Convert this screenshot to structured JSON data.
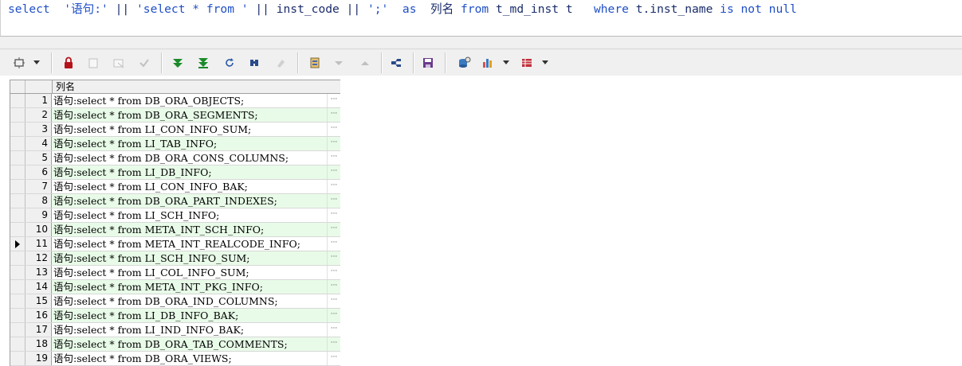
{
  "sql": {
    "tokens": [
      {
        "cls": "kw",
        "text": "select"
      },
      {
        "cls": "id",
        "text": "  "
      },
      {
        "cls": "str",
        "text": "'语句:'"
      },
      {
        "cls": "id",
        "text": " || "
      },
      {
        "cls": "str",
        "text": "'select * from '"
      },
      {
        "cls": "id",
        "text": " || inst_code || "
      },
      {
        "cls": "str",
        "text": "';'"
      },
      {
        "cls": "id",
        "text": "  "
      },
      {
        "cls": "kw",
        "text": "as"
      },
      {
        "cls": "id",
        "text": "  列名 "
      },
      {
        "cls": "kw",
        "text": "from"
      },
      {
        "cls": "id",
        "text": " t_md_inst t   "
      },
      {
        "cls": "kw",
        "text": "where"
      },
      {
        "cls": "id",
        "text": " t.inst_name "
      },
      {
        "cls": "kw",
        "text": "is not null"
      }
    ]
  },
  "toolbar": {
    "icons": [
      "pin-menu-icon",
      "lock-icon",
      "new-record-icon",
      "delete-record-icon",
      "post-icon",
      "fetch-next-icon",
      "fetch-all-icon",
      "refresh-icon",
      "find-icon",
      "clear-icon",
      "query-by-example-icon",
      "previous-icon",
      "next-icon",
      "single-record-view-icon",
      "save-icon",
      "export-icon",
      "chart-icon",
      "grid-view-icon"
    ]
  },
  "grid": {
    "column_header": "列名",
    "current_row": 11,
    "rows": [
      {
        "num": "1",
        "value": "语句:select * from DB_ORA_OBJECTS;"
      },
      {
        "num": "2",
        "value": "语句:select * from DB_ORA_SEGMENTS;"
      },
      {
        "num": "3",
        "value": "语句:select * from LI_CON_INFO_SUM;"
      },
      {
        "num": "4",
        "value": "语句:select * from LI_TAB_INFO;"
      },
      {
        "num": "5",
        "value": "语句:select * from DB_ORA_CONS_COLUMNS;"
      },
      {
        "num": "6",
        "value": "语句:select * from LI_DB_INFO;"
      },
      {
        "num": "7",
        "value": "语句:select * from LI_CON_INFO_BAK;"
      },
      {
        "num": "8",
        "value": "语句:select * from DB_ORA_PART_INDEXES;"
      },
      {
        "num": "9",
        "value": "语句:select * from LI_SCH_INFO;"
      },
      {
        "num": "10",
        "value": "语句:select * from META_INT_SCH_INFO;"
      },
      {
        "num": "11",
        "value": "语句:select * from META_INT_REALCODE_INFO;"
      },
      {
        "num": "12",
        "value": "语句:select * from LI_SCH_INFO_SUM;"
      },
      {
        "num": "13",
        "value": "语句:select * from LI_COL_INFO_SUM;"
      },
      {
        "num": "14",
        "value": "语句:select * from META_INT_PKG_INFO;"
      },
      {
        "num": "15",
        "value": "语句:select * from DB_ORA_IND_COLUMNS;"
      },
      {
        "num": "16",
        "value": "语句:select * from LI_DB_INFO_BAK;"
      },
      {
        "num": "17",
        "value": "语句:select * from LI_IND_INFO_BAK;"
      },
      {
        "num": "18",
        "value": "语句:select * from DB_ORA_TAB_COMMENTS;"
      },
      {
        "num": "19",
        "value": "语句:select * from DB_ORA_VIEWS;"
      }
    ],
    "dots": "···"
  },
  "colors": {
    "keyword": "#1f4fc6",
    "alt_row": "#e8fbe8"
  }
}
